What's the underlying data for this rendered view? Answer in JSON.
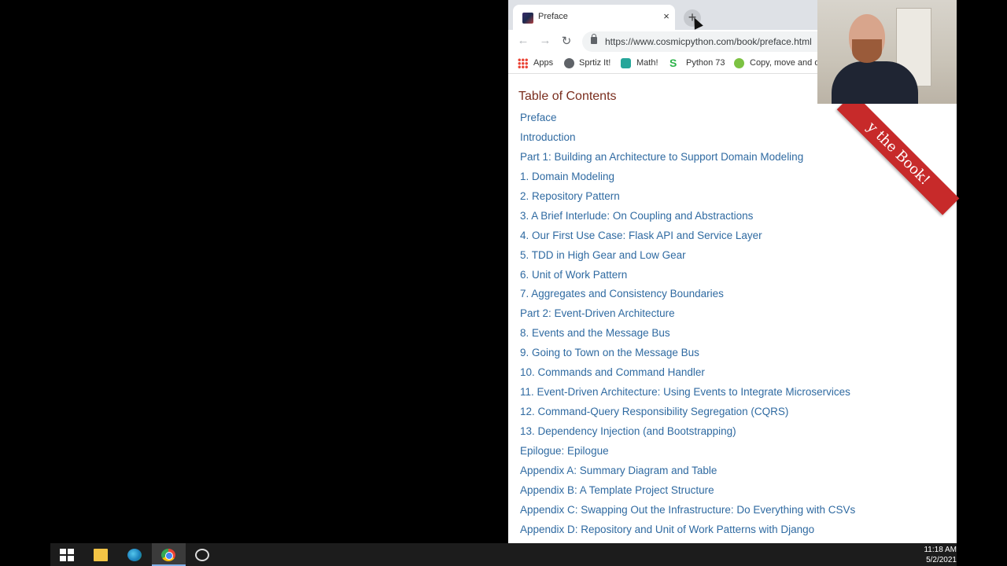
{
  "browser": {
    "tab_title": "Preface",
    "tab_close": "×",
    "new_tab": "+",
    "url": "https://www.cosmicpython.com/book/preface.html",
    "bookmarks": [
      "Apps",
      "Sprtiz It!",
      "Math!",
      "Python 73",
      "Copy, move and de"
    ]
  },
  "page": {
    "toc_heading": "Table of Contents",
    "toc_items": [
      "Preface",
      "Introduction",
      "Part 1: Building an Architecture to Support Domain Modeling",
      "1. Domain Modeling",
      "2. Repository Pattern",
      "3. A Brief Interlude: On Coupling and Abstractions",
      "4. Our First Use Case: Flask API and Service Layer",
      "5. TDD in High Gear and Low Gear",
      "6. Unit of Work Pattern",
      "7. Aggregates and Consistency Boundaries",
      "Part 2: Event-Driven Architecture",
      "8. Events and the Message Bus",
      "9. Going to Town on the Message Bus",
      "10. Commands and Command Handler",
      "11. Event-Driven Architecture: Using Events to Integrate Microservices",
      "12. Command-Query Responsibility Segregation (CQRS)",
      "13. Dependency Injection (and Bootstrapping)",
      "Epilogue: Epilogue",
      "Appendix A: Summary Diagram and Table",
      "Appendix B: A Template Project Structure",
      "Appendix C: Swapping Out the Infrastructure: Do Everything with CSVs",
      "Appendix D: Repository and Unit of Work Patterns with Django"
    ],
    "ribbon_text": "y the Book!"
  },
  "taskbar": {
    "time": "11:18 AM",
    "date": "5/2/2021"
  },
  "colors": {
    "link": "#2f6aa1",
    "heading": "#7a2e1e",
    "ribbon": "#c72a2a"
  }
}
